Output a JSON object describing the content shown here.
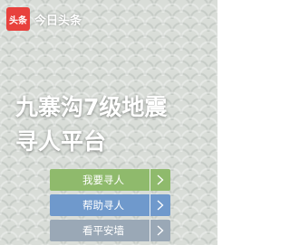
{
  "brand": {
    "logo_text": "头条",
    "name": "今日头条",
    "logo_color": "#e8413c"
  },
  "headline": {
    "line1": "九寨沟7级地震",
    "line2": "寻人平台"
  },
  "actions": [
    {
      "label": "我要寻人",
      "color": "#8fba6c",
      "icon": "chevron-right-icon"
    },
    {
      "label": "帮助寻人",
      "color": "#6f99cc",
      "icon": "chevron-right-icon"
    },
    {
      "label": "看平安墙",
      "color": "#9aa8b6",
      "icon": "chevron-right-icon"
    }
  ]
}
